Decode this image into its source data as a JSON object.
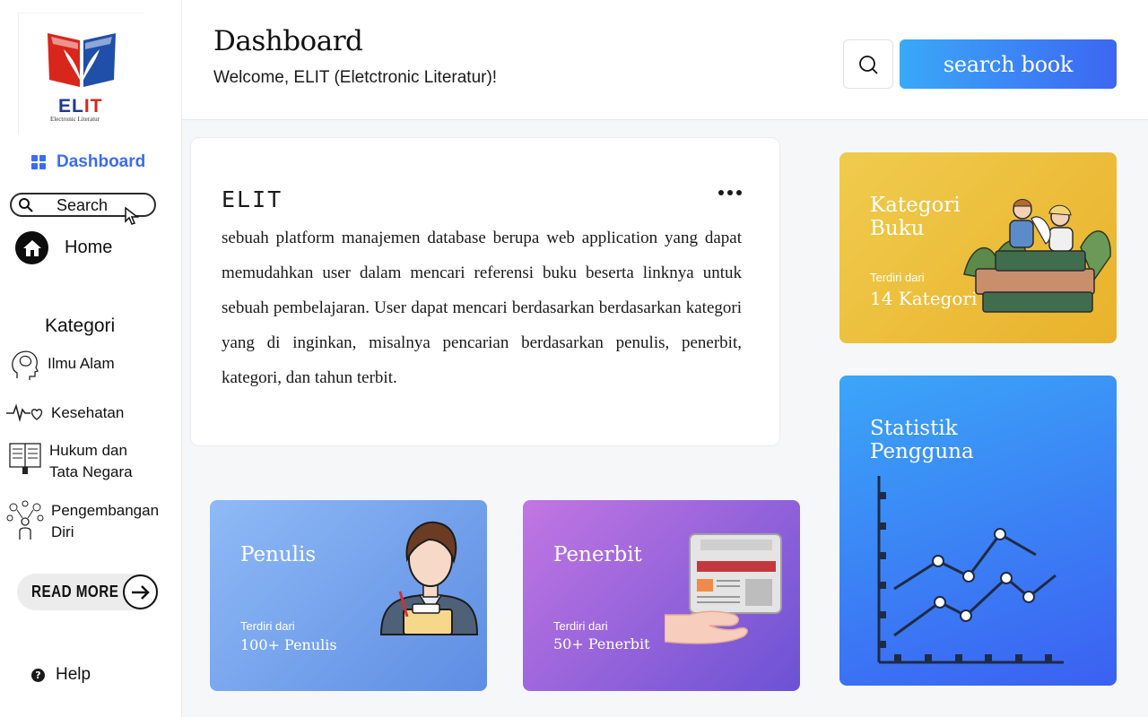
{
  "brand": {
    "logo_main_blue": "EL",
    "logo_main_red": "IT",
    "logo_sub": "Electronic Literatur"
  },
  "sidebar": {
    "dashboard_label": "Dashboard",
    "search_label": "Search",
    "home_label": "Home",
    "kategori_title": "Kategori",
    "categories": [
      {
        "label": "Ilmu Alam",
        "icon": "brain-icon"
      },
      {
        "label": "Kesehatan",
        "icon": "heartbeat-icon"
      },
      {
        "label": "Hukum dan Tata Negara",
        "line1": "Hukum dan",
        "line2": "Tata Negara",
        "icon": "law-book-icon"
      },
      {
        "label": "Pengembangan Diri",
        "line1": "Pengembangan",
        "line2": "Diri",
        "icon": "self-development-icon"
      }
    ],
    "read_more_label": "READ MORE",
    "help_label": "Help"
  },
  "header": {
    "title": "Dashboard",
    "welcome": "Welcome, ELIT (Eletctronic Literatur)!",
    "search_button_label": "search book"
  },
  "about": {
    "heading": "ELIT",
    "body": "sebuah platform manajemen database berupa web application yang dapat memudahkan user dalam mencari referensi buku beserta linknya untuk sebuah pembelajaran. User dapat mencari berdasarkan berdasarkan kategori yang di inginkan, misalnya pencarian berdasarkan penulis, penerbit, kategori, dan tahun terbit."
  },
  "cards": {
    "penulis": {
      "title": "Penulis",
      "sub": "Terdiri dari",
      "value": "100+ Penulis"
    },
    "penerbit": {
      "title": "Penerbit",
      "sub": "Terdiri dari",
      "value": "50+ Penerbit"
    },
    "kategori": {
      "title_line1": "Kategori",
      "title_line2": "Buku",
      "sub": "Terdiri dari",
      "value": "14 Kategori"
    },
    "statistik": {
      "title_line1": "Statistik",
      "title_line2": "Pengguna"
    }
  },
  "colors": {
    "accent": "#3a6cf4",
    "penulis_card": "#7aa6ee",
    "penerbit_card": "#9a63dc",
    "kategori_card": "#ecbf3d",
    "statistik_card": "#3b84f5"
  }
}
